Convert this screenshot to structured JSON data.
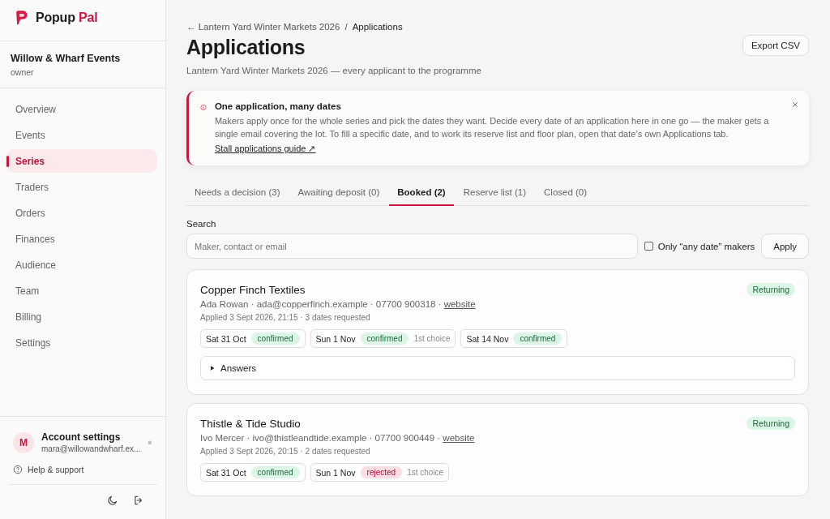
{
  "brand": {
    "name_part_1": "Popup",
    "name_part_2": "Pal"
  },
  "organisation": {
    "name": "Willow & Wharf Events",
    "role": "owner"
  },
  "sidebar": {
    "items": [
      {
        "label": "Overview",
        "selected": false
      },
      {
        "label": "Events",
        "selected": false
      },
      {
        "label": "Series",
        "selected": true
      },
      {
        "label": "Traders",
        "selected": false
      },
      {
        "label": "Orders",
        "selected": false
      },
      {
        "label": "Finances",
        "selected": false
      },
      {
        "label": "Audience",
        "selected": false
      },
      {
        "label": "Team",
        "selected": false
      },
      {
        "label": "Billing",
        "selected": false
      },
      {
        "label": "Settings",
        "selected": false
      }
    ]
  },
  "account": {
    "avatar_initial": "M",
    "title": "Account settings",
    "email": "mara@willowandwharf.ex..."
  },
  "help": {
    "label": "Help & support"
  },
  "breadcrumb": {
    "back_arrow": "←",
    "parent": "Lantern Yard Winter Markets 2026",
    "separator": "/",
    "current": "Applications"
  },
  "page": {
    "title": "Applications",
    "subtitle": "Lantern Yard Winter Markets 2026 — every applicant to the programme",
    "export_button": "Export CSV"
  },
  "notice": {
    "title": "One application, many dates",
    "body": "Makers apply once for the whole series and pick the dates they want. Decide every date of an application here in one go — the maker gets a single email covering the lot. To fill a specific date, and to work its reserve list and floor plan, open that date’s own Applications tab.",
    "link": "Stall applications guide ↗"
  },
  "tabs": [
    {
      "label": "Needs a decision (3)",
      "selected": false
    },
    {
      "label": "Awaiting deposit (0)",
      "selected": false
    },
    {
      "label": "Booked (2)",
      "selected": true
    },
    {
      "label": "Reserve list (1)",
      "selected": false
    },
    {
      "label": "Closed (0)",
      "selected": false
    }
  ],
  "search": {
    "label": "Search",
    "placeholder": "Maker, contact or email",
    "any_date_filter": {
      "label": "Only “any date” makers",
      "checked": false
    },
    "apply_button": "Apply"
  },
  "applications": [
    {
      "name": "Copper Finch Textiles",
      "badge": "Returning",
      "contact": "Ada Rowan · ada@copperfinch.example · 07700 900318 · ",
      "website_link": "website",
      "applied": "Applied 3 Sept 2026, 21:15 · 3 dates requested",
      "dates": [
        {
          "date": "Sat 31 Oct",
          "status": "confirmed",
          "kind": "positive"
        },
        {
          "date": "Sun 1 Nov",
          "status": "confirmed",
          "kind": "positive",
          "note": "1st choice"
        },
        {
          "date": "Sat 14 Nov",
          "status": "confirmed",
          "kind": "positive"
        }
      ],
      "answers": {
        "label": "Answers",
        "expanded": false
      }
    },
    {
      "name": "Thistle & Tide Studio",
      "badge": "Returning",
      "contact": "Ivo Mercer · ivo@thistleandtide.example · 07700 900449 · ",
      "website_link": "website",
      "applied": "Applied 3 Sept 2026, 20:15 · 2 dates requested",
      "dates": [
        {
          "date": "Sat 31 Oct",
          "status": "confirmed",
          "kind": "positive"
        },
        {
          "date": "Sun 1 Nov",
          "status": "rejected",
          "kind": "negative",
          "note": "1st choice"
        }
      ]
    }
  ]
}
